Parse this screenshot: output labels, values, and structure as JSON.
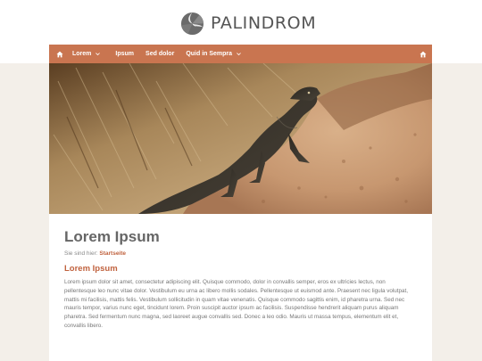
{
  "site": {
    "logo_text": "PALINDROM"
  },
  "nav": {
    "items": [
      {
        "label": "Lorem",
        "has_dropdown": true
      },
      {
        "label": "Ipsum",
        "has_dropdown": false
      },
      {
        "label": "Sed dolor",
        "has_dropdown": false
      },
      {
        "label": "Quid in Sempra",
        "has_dropdown": true
      }
    ],
    "home_icon": "home-icon",
    "right_icon": "accessibility-icon"
  },
  "hero": {
    "image": "lizard-on-rock-photo"
  },
  "content": {
    "title": "Lorem Ipsum",
    "breadcrumb_prefix": "Sie sind hier:",
    "breadcrumb_link": "Startseite",
    "subtitle": "Lorem Ipsum",
    "body": "Lorem ipsum dolor sit amet, consectetur adipiscing elit. Quisque commodo, dolor in convallis semper, eros ex ultricies lectus, non pellentesque leo nunc vitae dolor. Vestibulum eu urna ac libero mollis sodales. Pellentesque ut euismod ante. Praesent nec ligula volutpat, mattis mi facilisis, mattis felis. Vestibulum sollicitudin in quam vitae venenatis. Quisque commodo sagittis enim, id pharetra urna. Sed nec mauris tempor, varius nunc eget, tincidunt lorem. Proin suscipit auctor ipsum ac facilisis. Suspendisse hendrerit aliquam purus aliquam pharetra. Sed fermentum nunc magna, sed laoreet augue convallis sed. Donec a leo odio. Mauris ut massa tempus, elementum elit et, convallis libero."
  },
  "colors": {
    "accent": "#c97550",
    "link": "#c0623e",
    "band": "#f3efe9"
  }
}
